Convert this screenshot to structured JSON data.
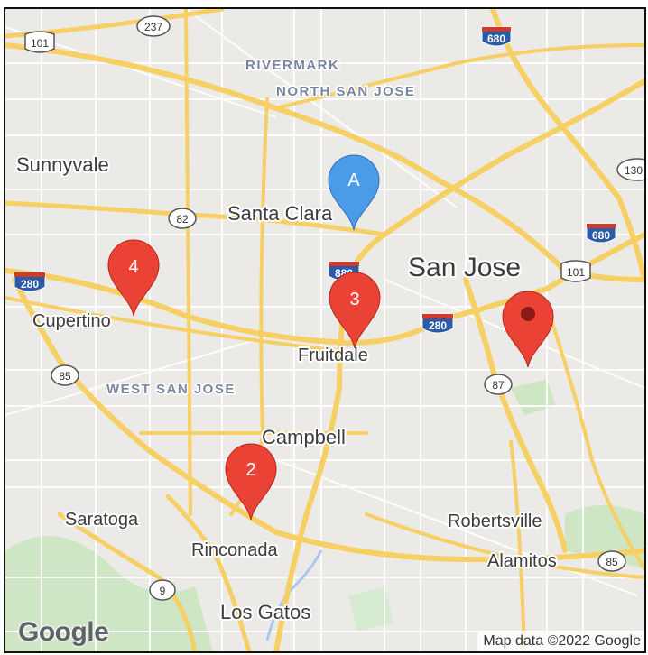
{
  "map": {
    "places": {
      "sunnyvale": "Sunnyvale",
      "santa_clara": "Santa Clara",
      "san_jose": "San Jose",
      "cupertino": "Cupertino",
      "fruitdale": "Fruitdale",
      "campbell": "Campbell",
      "saratoga": "Saratoga",
      "rinconada": "Rinconada",
      "los_gatos": "Los Gatos",
      "robertsville": "Robertsville",
      "alamitos": "Alamitos"
    },
    "districts": {
      "rivermark": "RIVERMARK",
      "north_san_jose": "NORTH SAN JOSE",
      "west_san_jose": "WEST SAN JOSE"
    },
    "highways": {
      "us101_a": "101",
      "us101_b": "101",
      "ca237": "237",
      "i680_a": "680",
      "i680_b": "680",
      "ca130": "130",
      "ca82": "82",
      "i280_a": "280",
      "i280_b": "280",
      "i880": "880",
      "ca85_a": "85",
      "ca85_b": "85",
      "ca87": "87",
      "ca9": "9"
    },
    "markers": {
      "a": "A",
      "m2": "2",
      "m3": "3",
      "m4": "4"
    },
    "colors": {
      "marker_red": "#ea4335",
      "marker_blue": "#4a9be8",
      "road_yellow": "#f6cf65",
      "land": "#eceae6",
      "park_green": "#cfe6c5"
    },
    "logo": "Google",
    "attribution": "Map data ©2022 Google"
  }
}
